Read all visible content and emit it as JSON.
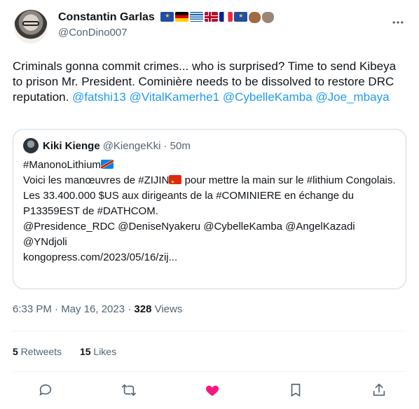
{
  "author": {
    "display_name": "Constantin Garlas",
    "handle": "@ConDino007",
    "badges": [
      "eu-flag",
      "germany-flag",
      "greece-flag",
      "norway-flag",
      "france-flag",
      "eu-flag",
      "raised-fist-emoji",
      "otter-emoji"
    ]
  },
  "tweet": {
    "text_lead": "Criminals gonna commit crimes... who is surprised? Time to send Kibeya to prison Mr. President. Cominière needs to be dissolved to restore DRC reputation.",
    "mentions": [
      "@fatshi13",
      "@VitalKamerhe1",
      "@CybelleKamba",
      "@Joe_mbaya"
    ]
  },
  "quote": {
    "display_name": "Kiki Kienge",
    "handle": "@KiengeKki",
    "time": "· 50m",
    "line1": "#ManonoLithium",
    "line2a": "Voici les manœuvres de #ZIJIN",
    "line2b": " pour mettre la main sur le #lithium Congolais.",
    "line3": "Les 33.400.000 $US aux dirigeants de la #COMINIERE en échange du P13359EST de #DATHCOM.",
    "line4": "@Presidence_RDC @DeniseNyakeru @CybelleKamba @AngelKazadi @YNdjoli",
    "line5": "kongopress.com/2023/05/16/zij..."
  },
  "meta": {
    "time": "6:33 PM · May 16, 2023 · ",
    "views_count": "328",
    "views_label": " Views"
  },
  "stats": {
    "retweets_count": "5",
    "retweets_label": " Retweets",
    "likes_count": "15",
    "likes_label": " Likes"
  },
  "colors": {
    "link": "#1d9bf0",
    "like_active": "#f91880",
    "icon": "#536471"
  },
  "actions": [
    "reply-icon",
    "retweet-icon",
    "like-icon",
    "bookmark-icon",
    "share-icon"
  ]
}
